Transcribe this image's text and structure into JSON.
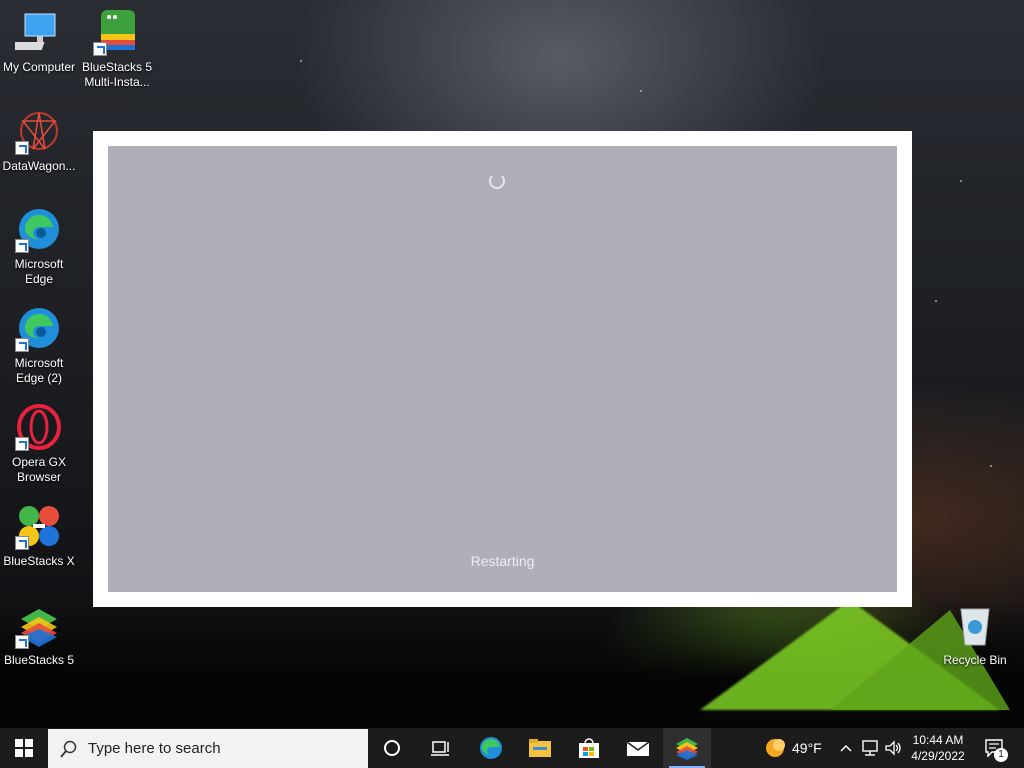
{
  "desktop": {
    "icons": [
      {
        "label": "My Computer",
        "icon": "computer-icon"
      },
      {
        "label": "BlueStacks 5 Multi-Insta...",
        "icon": "bluestacks-multi-instance-icon"
      },
      {
        "label": "DataWagon...",
        "icon": "datawagon-icon"
      },
      {
        "label": "Microsoft Edge",
        "icon": "edge-icon"
      },
      {
        "label": "Microsoft Edge (2)",
        "icon": "edge-icon"
      },
      {
        "label": "Opera GX Browser",
        "icon": "opera-gx-icon"
      },
      {
        "label": "BlueStacks X",
        "icon": "bluestacks-x-icon"
      },
      {
        "label": "BlueStacks 5",
        "icon": "bluestacks-icon"
      },
      {
        "label": "Recycle Bin",
        "icon": "recycle-bin-icon"
      }
    ]
  },
  "dialog": {
    "status": "Restarting",
    "accent": "#aeafb9"
  },
  "taskbar": {
    "search_placeholder": "Type here to search",
    "weather_temp": "49°F",
    "time": "10:44 AM",
    "date": "4/29/2022",
    "notification_count": "1",
    "pinned": [
      "edge-icon",
      "file-explorer-icon",
      "microsoft-store-icon",
      "mail-icon",
      "bluestacks-icon"
    ]
  }
}
